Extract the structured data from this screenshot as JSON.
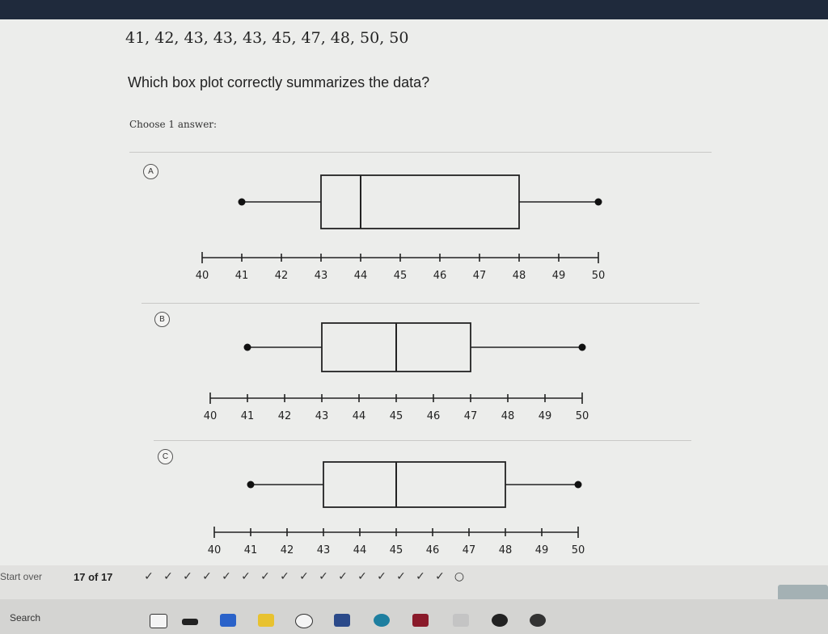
{
  "problem": {
    "dataset": "41, 42, 43, 43, 43, 45, 47, 48, 50, 50",
    "question": "Which box plot correctly summarizes the data?",
    "instruction": "Choose 1 answer:"
  },
  "options": [
    {
      "letter": "A",
      "box_plot": {
        "min": 41,
        "q1": 43,
        "median": 44,
        "q3": 48,
        "max": 50
      }
    },
    {
      "letter": "B",
      "box_plot": {
        "min": 41,
        "q1": 43,
        "median": 45,
        "q3": 47,
        "max": 50
      }
    },
    {
      "letter": "C",
      "box_plot": {
        "min": 41,
        "q1": 43,
        "median": 45,
        "q3": 48,
        "max": 50
      }
    }
  ],
  "axis": {
    "min": 40,
    "max": 50,
    "ticks": [
      "40",
      "41",
      "42",
      "43",
      "44",
      "45",
      "46",
      "47",
      "48",
      "49",
      "50"
    ]
  },
  "footer": {
    "start_over": "Start over",
    "progress": "17 of 17",
    "checks": [
      "✓",
      "✓",
      "✓",
      "✓",
      "✓",
      "✓",
      "✓",
      "✓",
      "✓",
      "✓",
      "✓",
      "✓",
      "✓",
      "✓",
      "✓",
      "✓",
      "○"
    ]
  },
  "taskbar": {
    "search": "Search"
  },
  "colors": {
    "topbar": "#1f2a3c",
    "page": "#ecedeb",
    "check_button": "#a4b1b4"
  }
}
